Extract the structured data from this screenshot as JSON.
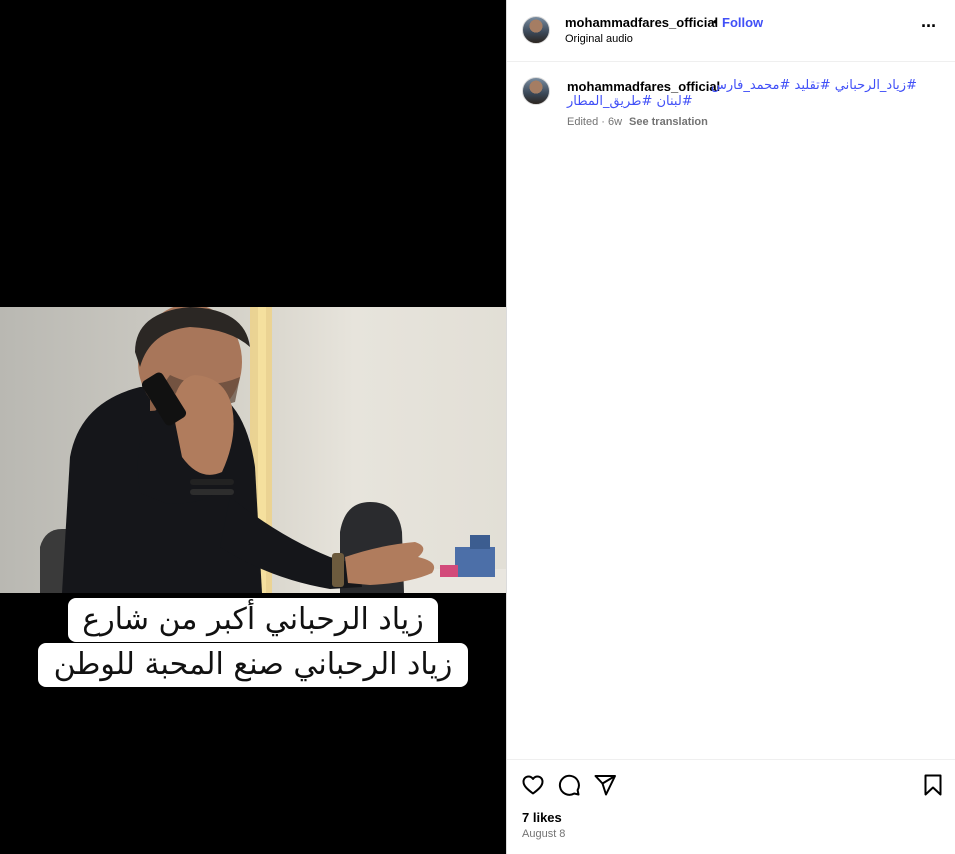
{
  "post": {
    "username": "mohammadfares_official",
    "follow_label": "Follow",
    "separator": "•",
    "audio_label": "Original audio",
    "more_label": "···"
  },
  "video": {
    "caption_line_1": "زياد الرحباني أكبر من شارع",
    "caption_line_2": "زياد الرحباني صنع المحبة للوطن"
  },
  "comment": {
    "username": "mohammadfares_official",
    "hashtags_line_1": "#زياد_الرحباني #تقليد #محمد_فارس",
    "hashtags_line_2": "#لبنان #طريق_المطار",
    "meta": "Edited · 6w",
    "see_translation": "See translation"
  },
  "actions": {
    "icons": [
      "heart-icon",
      "comment-icon",
      "share-icon",
      "bookmark-icon"
    ],
    "likes": "7 likes",
    "date": "August 8"
  },
  "colors": {
    "link_blue": "#4150f7",
    "muted": "#737373",
    "divider": "#efefef"
  }
}
